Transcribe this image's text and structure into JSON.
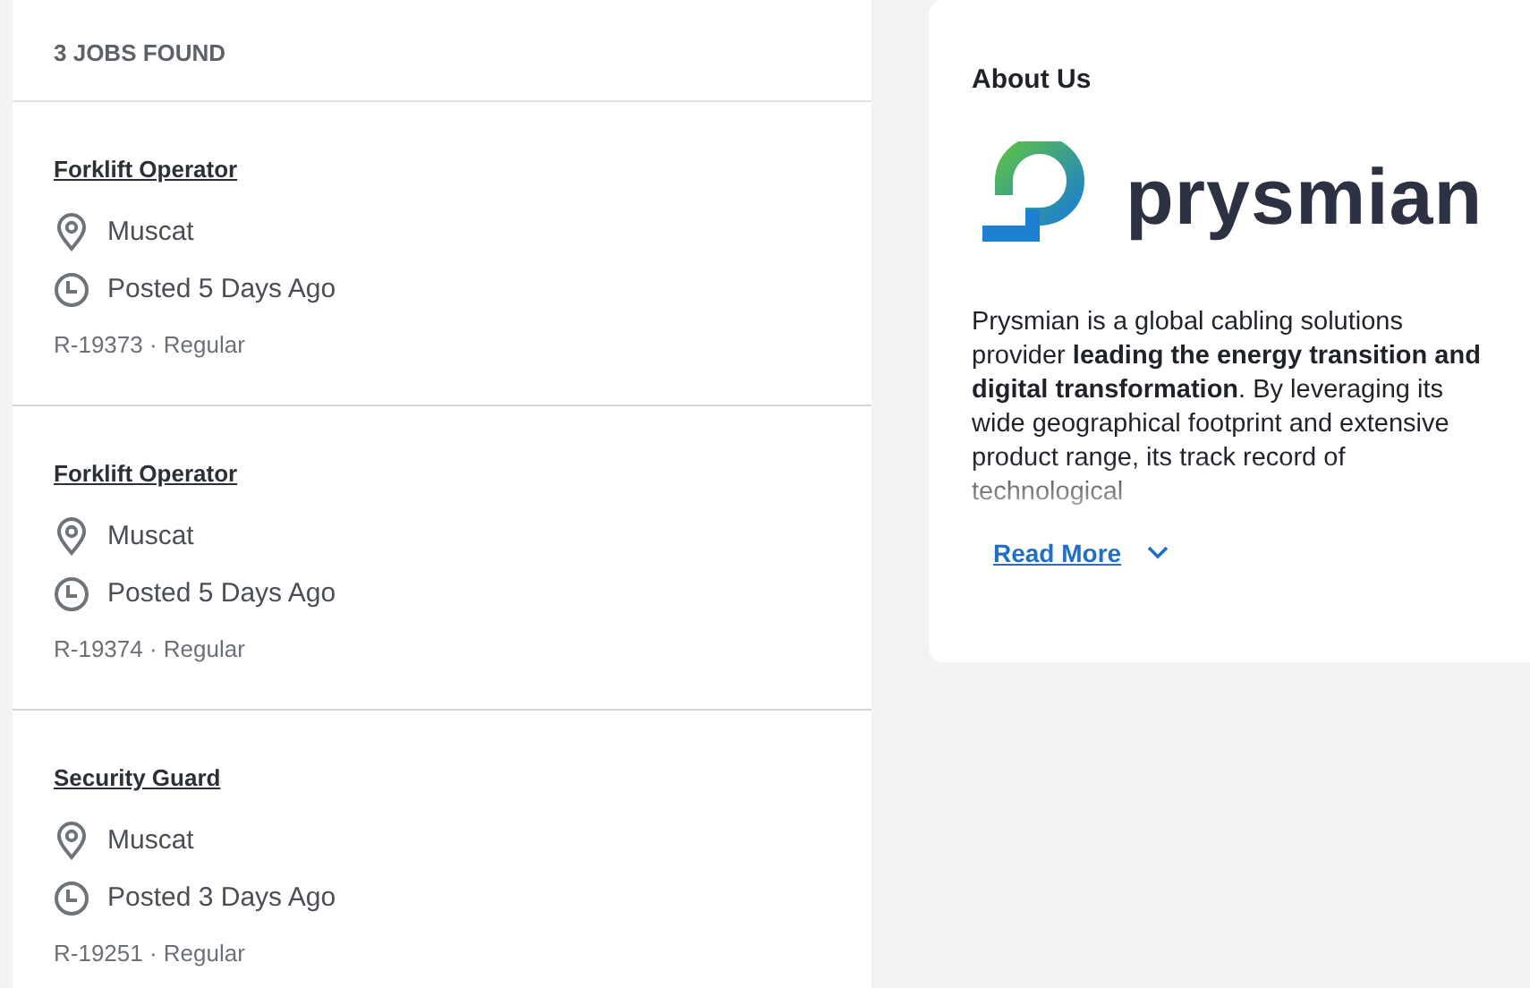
{
  "jobs_panel": {
    "count_label": "3 JOBS FOUND",
    "jobs": [
      {
        "title": "Forklift Operator",
        "location": "Muscat",
        "posted": "Posted 5 Days Ago",
        "meta": "R-19373 · Regular"
      },
      {
        "title": "Forklift Operator",
        "location": "Muscat",
        "posted": "Posted 5 Days Ago",
        "meta": "R-19374 · Regular"
      },
      {
        "title": "Security Guard",
        "location": "Muscat",
        "posted": "Posted 3 Days Ago",
        "meta": "R-19251 · Regular"
      }
    ]
  },
  "about": {
    "heading": "About Us",
    "logo_text": "prysmian",
    "text": "Prysmian is a global cabling solutions provider **leading the energy transition and digital transformation**. By leveraging its wide geographical footprint and extensive product range, its track record of technological",
    "read_more": "Read More"
  }
}
